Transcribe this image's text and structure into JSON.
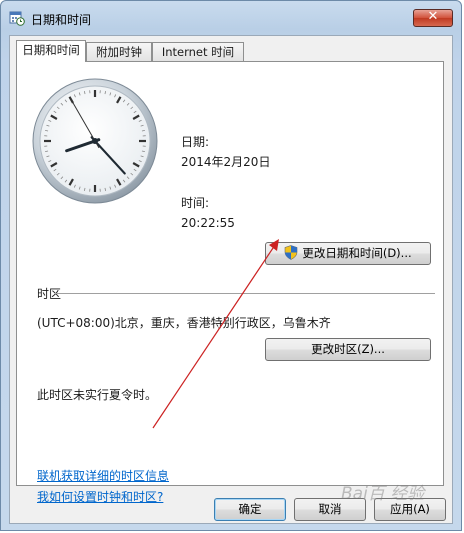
{
  "window": {
    "title": "日期和时间",
    "close_glyph": "✕"
  },
  "tabs": [
    {
      "label": "日期和时间"
    },
    {
      "label": "附加时钟"
    },
    {
      "label": "Internet 时间"
    }
  ],
  "datetime": {
    "date_label": "日期:",
    "date_value": "2014年2月20日",
    "time_label": "时间:",
    "time_value": "20:22:55",
    "change_button": "更改日期和时间(D)..."
  },
  "clock": {
    "hour": 20,
    "minute": 22,
    "second": 55
  },
  "timezone": {
    "section_label": "时区",
    "value": "(UTC+08:00)北京，重庆，香港特别行政区，乌鲁木齐",
    "change_button": "更改时区(Z)...",
    "dst_note": "此时区未实行夏令时。"
  },
  "links": {
    "online_info": "联机获取详细的时区信息",
    "how_to": "我如何设置时钟和时区?"
  },
  "footer": {
    "ok": "确定",
    "cancel": "取消",
    "apply": "应用(A)"
  },
  "watermark": "Bai百 经验",
  "colors": {
    "link": "#0066cc",
    "annotation_arrow": "#cc2222",
    "close_button": "#c8452d"
  }
}
